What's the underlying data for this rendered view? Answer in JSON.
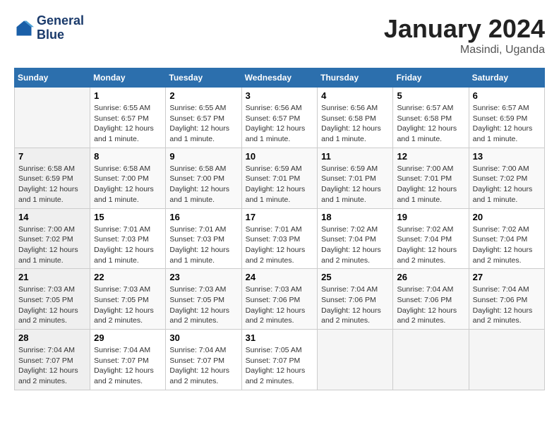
{
  "header": {
    "logo": {
      "line1": "General",
      "line2": "Blue"
    },
    "title": "January 2024",
    "location": "Masindi, Uganda"
  },
  "weekdays": [
    "Sunday",
    "Monday",
    "Tuesday",
    "Wednesday",
    "Thursday",
    "Friday",
    "Saturday"
  ],
  "weeks": [
    [
      {
        "day": "",
        "info": ""
      },
      {
        "day": "1",
        "info": "Sunrise: 6:55 AM\nSunset: 6:57 PM\nDaylight: 12 hours\nand 1 minute."
      },
      {
        "day": "2",
        "info": "Sunrise: 6:55 AM\nSunset: 6:57 PM\nDaylight: 12 hours\nand 1 minute."
      },
      {
        "day": "3",
        "info": "Sunrise: 6:56 AM\nSunset: 6:57 PM\nDaylight: 12 hours\nand 1 minute."
      },
      {
        "day": "4",
        "info": "Sunrise: 6:56 AM\nSunset: 6:58 PM\nDaylight: 12 hours\nand 1 minute."
      },
      {
        "day": "5",
        "info": "Sunrise: 6:57 AM\nSunset: 6:58 PM\nDaylight: 12 hours\nand 1 minute."
      },
      {
        "day": "6",
        "info": "Sunrise: 6:57 AM\nSunset: 6:59 PM\nDaylight: 12 hours\nand 1 minute."
      }
    ],
    [
      {
        "day": "7",
        "info": "Sunrise: 6:58 AM\nSunset: 6:59 PM\nDaylight: 12 hours\nand 1 minute."
      },
      {
        "day": "8",
        "info": "Sunrise: 6:58 AM\nSunset: 7:00 PM\nDaylight: 12 hours\nand 1 minute."
      },
      {
        "day": "9",
        "info": "Sunrise: 6:58 AM\nSunset: 7:00 PM\nDaylight: 12 hours\nand 1 minute."
      },
      {
        "day": "10",
        "info": "Sunrise: 6:59 AM\nSunset: 7:01 PM\nDaylight: 12 hours\nand 1 minute."
      },
      {
        "day": "11",
        "info": "Sunrise: 6:59 AM\nSunset: 7:01 PM\nDaylight: 12 hours\nand 1 minute."
      },
      {
        "day": "12",
        "info": "Sunrise: 7:00 AM\nSunset: 7:01 PM\nDaylight: 12 hours\nand 1 minute."
      },
      {
        "day": "13",
        "info": "Sunrise: 7:00 AM\nSunset: 7:02 PM\nDaylight: 12 hours\nand 1 minute."
      }
    ],
    [
      {
        "day": "14",
        "info": "Sunrise: 7:00 AM\nSunset: 7:02 PM\nDaylight: 12 hours\nand 1 minute."
      },
      {
        "day": "15",
        "info": "Sunrise: 7:01 AM\nSunset: 7:03 PM\nDaylight: 12 hours\nand 1 minute."
      },
      {
        "day": "16",
        "info": "Sunrise: 7:01 AM\nSunset: 7:03 PM\nDaylight: 12 hours\nand 1 minute."
      },
      {
        "day": "17",
        "info": "Sunrise: 7:01 AM\nSunset: 7:03 PM\nDaylight: 12 hours\nand 2 minutes."
      },
      {
        "day": "18",
        "info": "Sunrise: 7:02 AM\nSunset: 7:04 PM\nDaylight: 12 hours\nand 2 minutes."
      },
      {
        "day": "19",
        "info": "Sunrise: 7:02 AM\nSunset: 7:04 PM\nDaylight: 12 hours\nand 2 minutes."
      },
      {
        "day": "20",
        "info": "Sunrise: 7:02 AM\nSunset: 7:04 PM\nDaylight: 12 hours\nand 2 minutes."
      }
    ],
    [
      {
        "day": "21",
        "info": "Sunrise: 7:03 AM\nSunset: 7:05 PM\nDaylight: 12 hours\nand 2 minutes."
      },
      {
        "day": "22",
        "info": "Sunrise: 7:03 AM\nSunset: 7:05 PM\nDaylight: 12 hours\nand 2 minutes."
      },
      {
        "day": "23",
        "info": "Sunrise: 7:03 AM\nSunset: 7:05 PM\nDaylight: 12 hours\nand 2 minutes."
      },
      {
        "day": "24",
        "info": "Sunrise: 7:03 AM\nSunset: 7:06 PM\nDaylight: 12 hours\nand 2 minutes."
      },
      {
        "day": "25",
        "info": "Sunrise: 7:04 AM\nSunset: 7:06 PM\nDaylight: 12 hours\nand 2 minutes."
      },
      {
        "day": "26",
        "info": "Sunrise: 7:04 AM\nSunset: 7:06 PM\nDaylight: 12 hours\nand 2 minutes."
      },
      {
        "day": "27",
        "info": "Sunrise: 7:04 AM\nSunset: 7:06 PM\nDaylight: 12 hours\nand 2 minutes."
      }
    ],
    [
      {
        "day": "28",
        "info": "Sunrise: 7:04 AM\nSunset: 7:07 PM\nDaylight: 12 hours\nand 2 minutes."
      },
      {
        "day": "29",
        "info": "Sunrise: 7:04 AM\nSunset: 7:07 PM\nDaylight: 12 hours\nand 2 minutes."
      },
      {
        "day": "30",
        "info": "Sunrise: 7:04 AM\nSunset: 7:07 PM\nDaylight: 12 hours\nand 2 minutes."
      },
      {
        "day": "31",
        "info": "Sunrise: 7:05 AM\nSunset: 7:07 PM\nDaylight: 12 hours\nand 2 minutes."
      },
      {
        "day": "",
        "info": ""
      },
      {
        "day": "",
        "info": ""
      },
      {
        "day": "",
        "info": ""
      }
    ]
  ]
}
